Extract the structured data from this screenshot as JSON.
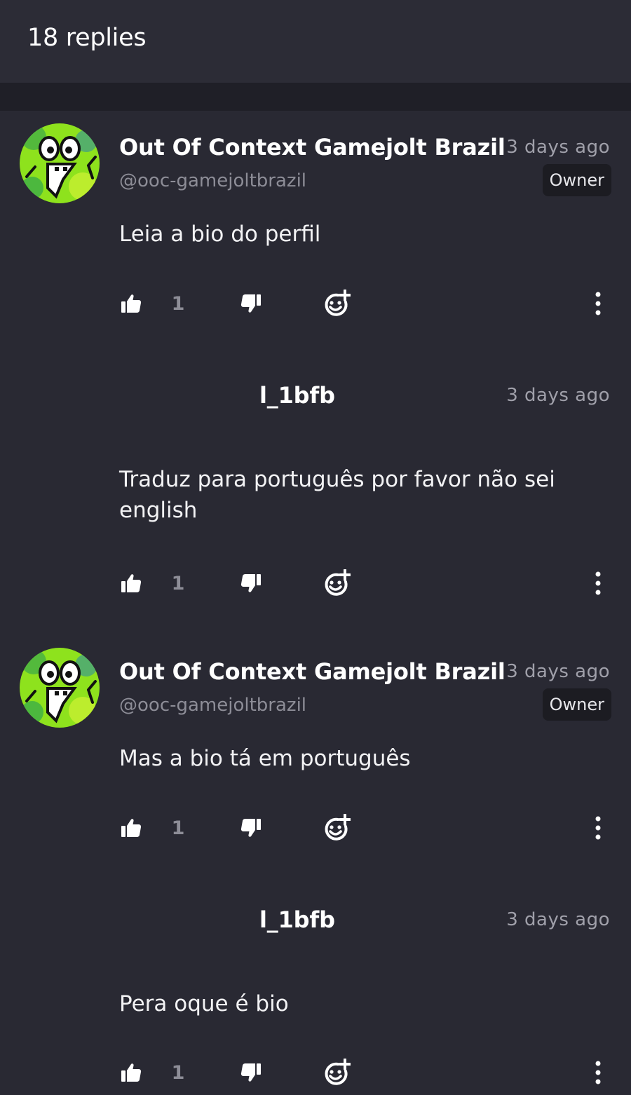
{
  "header": {
    "title": "18 replies"
  },
  "comments": [
    {
      "author": "Out Of Context Gamejolt Brazil",
      "handle": "@ooc-gamejoltbrazil",
      "time": "3 days ago",
      "badge": "Owner",
      "body": "Leia a bio do perfil",
      "likes": "1"
    },
    {
      "author": "l_1bfb",
      "time": "3 days ago",
      "body": "Traduz para português por favor não sei english",
      "likes": "1"
    },
    {
      "author": "Out Of Context Gamejolt Brazil",
      "handle": "@ooc-gamejoltbrazil",
      "time": "3 days ago",
      "badge": "Owner",
      "body": "Mas a bio tá em português",
      "likes": "1"
    },
    {
      "author": "l_1bfb",
      "time": "3 days ago",
      "body": "Pera oque é bio",
      "likes": "1"
    }
  ],
  "icons": {
    "like": "thumbs-up-icon",
    "dislike": "thumbs-down-icon",
    "react": "add-reaction-icon",
    "more": "more-vertical-icon"
  },
  "colors": {
    "background": "#292933",
    "header": "#2c2c36",
    "muted_text": "#8d8d97",
    "badge_bg": "#1c1c22",
    "avatar_green": "#8ee21d"
  }
}
